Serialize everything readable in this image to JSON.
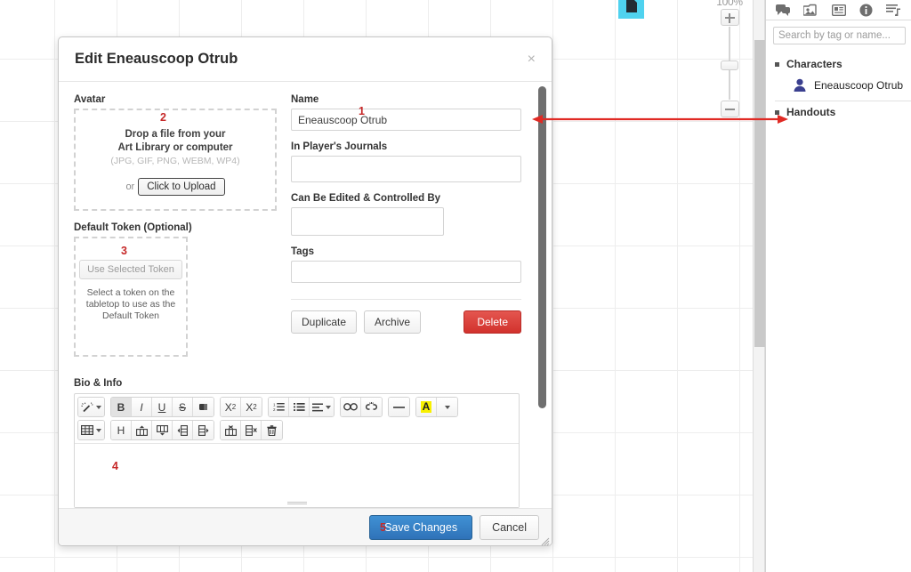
{
  "tabletop": {
    "zoom_level": "100%",
    "zoom_in_icon": "plus-icon",
    "zoom_out_icon": "minus-icon",
    "token_icon": "handout-token-icon"
  },
  "sidebar": {
    "tabs": [
      {
        "name": "chat-tab",
        "icon": "chat-bubbles-icon"
      },
      {
        "name": "art-library-tab",
        "icon": "art-library-icon"
      },
      {
        "name": "journal-tab",
        "icon": "journal-icon"
      },
      {
        "name": "compendium-tab",
        "icon": "info-circle-icon"
      },
      {
        "name": "collections-tab",
        "icon": "collections-list-icon"
      }
    ],
    "search": {
      "placeholder": "Search by tag or name..."
    },
    "groups": [
      {
        "label": "Characters",
        "items": [
          {
            "label": "Eneauscoop Otrub",
            "icon": "character-avatar-icon"
          }
        ]
      },
      {
        "label": "Handouts",
        "items": []
      }
    ]
  },
  "modal": {
    "title": "Edit Eneauscoop Otrub",
    "close_label": "×",
    "avatar": {
      "label": "Avatar",
      "drop_line_1": "Drop a file from your",
      "drop_line_2": "Art Library or computer",
      "formats": "(JPG, GIF, PNG, WEBM, WP4)",
      "or_label": "or",
      "upload_button": "Click to Upload"
    },
    "default_token": {
      "label": "Default Token (Optional)",
      "use_button": "Use Selected Token",
      "help_line_1": "Select a token on the",
      "help_line_2": "tabletop to use as the",
      "help_line_3": "Default Token"
    },
    "fields": {
      "name": {
        "label": "Name",
        "value": "Eneauscoop Otrub",
        "placeholder": ""
      },
      "journals": {
        "label": "In Player's Journals",
        "value": "",
        "placeholder": ""
      },
      "controlled_by": {
        "label": "Can Be Edited & Controlled By",
        "value": "",
        "placeholder": ""
      },
      "tags": {
        "label": "Tags",
        "value": "",
        "placeholder": ""
      }
    },
    "actions": {
      "duplicate": "Duplicate",
      "archive": "Archive",
      "delete": "Delete",
      "delete_color": "#d2322d"
    },
    "bio": {
      "label": "Bio & Info",
      "content": "",
      "toolbar_row_1": [
        {
          "name": "magic-wand-icon",
          "glyph": "wand",
          "caret": true,
          "active": false
        },
        {
          "name": "bold-button",
          "glyph": "B",
          "caret": false,
          "active": true
        },
        {
          "name": "italic-button",
          "glyph": "I",
          "caret": false,
          "active": false
        },
        {
          "name": "underline-button",
          "glyph": "U",
          "caret": false,
          "active": false
        },
        {
          "name": "strikethrough-button",
          "glyph": "S",
          "caret": false,
          "active": false
        },
        {
          "name": "eraser-icon",
          "glyph": "eraser",
          "caret": false,
          "active": false
        },
        {
          "name": "superscript-button",
          "glyph": "X2up",
          "caret": false,
          "active": false
        },
        {
          "name": "subscript-button",
          "glyph": "X2down",
          "caret": false,
          "active": false
        },
        {
          "name": "ordered-list-button",
          "glyph": "ol",
          "caret": false,
          "active": false
        },
        {
          "name": "unordered-list-button",
          "glyph": "ul",
          "caret": false,
          "active": false
        },
        {
          "name": "align-button",
          "glyph": "align",
          "caret": true,
          "active": false
        },
        {
          "name": "insert-link-button",
          "glyph": "link",
          "caret": false,
          "active": false
        },
        {
          "name": "unlink-button",
          "glyph": "unlink",
          "caret": false,
          "active": false
        },
        {
          "name": "horizontal-rule-button",
          "glyph": "hr",
          "caret": false,
          "active": false
        },
        {
          "name": "text-highlight-button",
          "glyph": "A",
          "caret": false,
          "active": false
        },
        {
          "name": "text-color-dropdown",
          "glyph": "dot",
          "caret": true,
          "active": false
        }
      ],
      "toolbar_row_2": [
        {
          "name": "insert-table-button",
          "glyph": "table",
          "caret": true,
          "active": false
        },
        {
          "name": "table-header-button",
          "glyph": "H",
          "caret": false,
          "active": false
        },
        {
          "name": "insert-row-above-button",
          "glyph": "rowabove",
          "caret": false,
          "active": false
        },
        {
          "name": "insert-row-below-button",
          "glyph": "rowbelow",
          "caret": false,
          "active": false
        },
        {
          "name": "insert-column-left-button",
          "glyph": "colleft",
          "caret": false,
          "active": false
        },
        {
          "name": "insert-column-right-button",
          "glyph": "colright",
          "caret": false,
          "active": false
        },
        {
          "name": "delete-row-button",
          "glyph": "delrow",
          "caret": false,
          "active": false
        },
        {
          "name": "delete-column-button",
          "glyph": "delcol",
          "caret": false,
          "active": false
        },
        {
          "name": "delete-table-button",
          "glyph": "trash",
          "caret": false,
          "active": false
        }
      ]
    },
    "footer": {
      "save": "Save Changes",
      "cancel": "Cancel"
    }
  },
  "annotations": {
    "marker_1": "1",
    "marker_2": "2",
    "marker_3": "3",
    "marker_4": "4",
    "marker_5": "5",
    "color": "#c62828",
    "arrow_name": "red-double-arrow"
  }
}
